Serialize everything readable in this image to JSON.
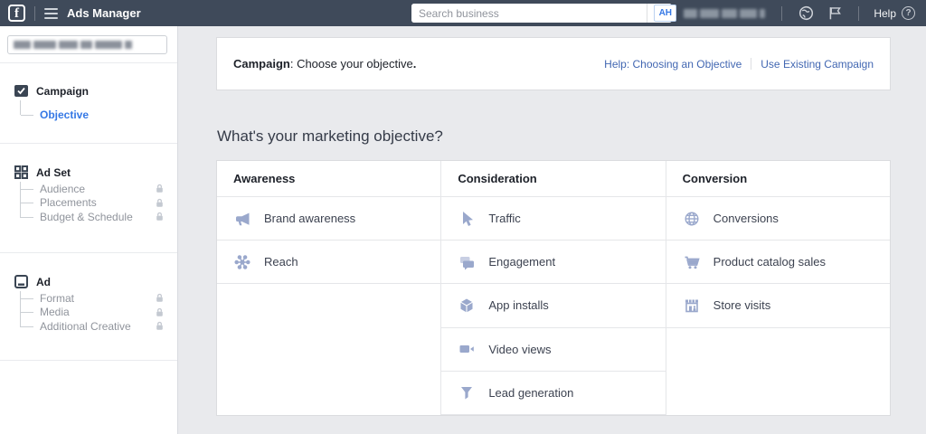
{
  "navbar": {
    "title": "Ads Manager",
    "search_placeholder": "Search business",
    "account_initials": "AH",
    "help_label": "Help"
  },
  "sidebar": {
    "campaign": {
      "label": "Campaign",
      "items": [
        {
          "label": "Objective",
          "active": true,
          "locked": false
        }
      ]
    },
    "ad_set": {
      "label": "Ad Set",
      "items": [
        {
          "label": "Audience",
          "locked": true
        },
        {
          "label": "Placements",
          "locked": true
        },
        {
          "label": "Budget & Schedule",
          "locked": true
        }
      ]
    },
    "ad": {
      "label": "Ad",
      "items": [
        {
          "label": "Format",
          "locked": true
        },
        {
          "label": "Media",
          "locked": true
        },
        {
          "label": "Additional Creative",
          "locked": true
        }
      ]
    }
  },
  "main": {
    "header": {
      "title_bold": "Campaign",
      "title_rest": ": Choose your objective",
      "title_period": ".",
      "links": [
        "Help: Choosing an Objective",
        "Use Existing Campaign"
      ]
    },
    "question": "What's your marketing objective?",
    "columns": [
      {
        "header": "Awareness",
        "items": [
          {
            "icon": "megaphone-icon",
            "label": "Brand awareness"
          },
          {
            "icon": "reach-icon",
            "label": "Reach"
          }
        ]
      },
      {
        "header": "Consideration",
        "items": [
          {
            "icon": "cursor-icon",
            "label": "Traffic"
          },
          {
            "icon": "speech-bubbles-icon",
            "label": "Engagement"
          },
          {
            "icon": "cube-icon",
            "label": "App installs"
          },
          {
            "icon": "video-camera-icon",
            "label": "Video views"
          },
          {
            "icon": "funnel-icon",
            "label": "Lead generation"
          }
        ]
      },
      {
        "header": "Conversion",
        "items": [
          {
            "icon": "globe-grid-icon",
            "label": "Conversions"
          },
          {
            "icon": "shopping-cart-icon",
            "label": "Product catalog sales"
          },
          {
            "icon": "storefront-icon",
            "label": "Store visits"
          }
        ]
      }
    ]
  },
  "colors": {
    "navbar_bg": "#3f4a5a",
    "link_blue": "#4267b2",
    "active_step_blue": "#3578e5",
    "objective_icon_blue": "#9aa8cc",
    "locked_gray": "#c4c9d1",
    "page_bg": "#e9eaed"
  }
}
